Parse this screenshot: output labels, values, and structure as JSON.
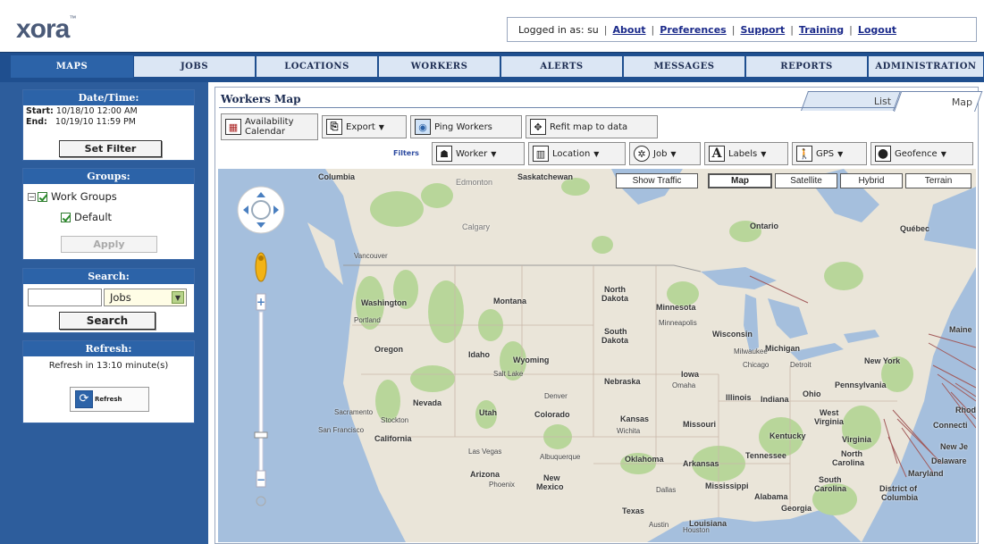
{
  "app": {
    "logo": "xora",
    "logo_mark": "™"
  },
  "header": {
    "logged_in_text": "Logged in as: su",
    "links": [
      "About",
      "Preferences",
      "Support",
      "Training",
      "Logout"
    ]
  },
  "nav": {
    "tabs": [
      "MAPS",
      "JOBS",
      "LOCATIONS",
      "WORKERS",
      "ALERTS",
      "MESSAGES",
      "REPORTS",
      "ADMINISTRATION"
    ],
    "active": "MAPS"
  },
  "sidebar": {
    "datetime": {
      "title": "Date/Time:",
      "start_label": "Start:",
      "start_value": "10/18/10 12:00 AM",
      "end_label": "End:",
      "end_value": "10/19/10 11:59 PM",
      "button": "Set Filter"
    },
    "groups": {
      "title": "Groups:",
      "items": [
        "Work Groups",
        "Default"
      ],
      "button": "Apply"
    },
    "search": {
      "title": "Search:",
      "input_value": "",
      "select_value": "Jobs",
      "button": "Search"
    },
    "refresh": {
      "title": "Refresh:",
      "text": "Refresh in 13:10 minute(s)",
      "button": "Refresh"
    }
  },
  "main": {
    "title": "Workers Map",
    "view_tabs": {
      "list": "List",
      "map": "Map"
    },
    "toolbar": {
      "availability_line1": "Availability",
      "availability_line2": "Calendar",
      "export": "Export",
      "ping": "Ping Workers",
      "refit": "Refit map to data"
    },
    "filters": {
      "label": "Filters",
      "items": [
        "Worker",
        "Location",
        "Job",
        "Labels",
        "GPS",
        "Geofence"
      ]
    },
    "map": {
      "show_traffic": "Show Traffic",
      "types": [
        "Map",
        "Satellite",
        "Hybrid",
        "Terrain"
      ],
      "active_type": "Map",
      "labels": {
        "columbia": "Columbia",
        "edmonton": "Edmonton",
        "saskatchewan": "Saskatchewan",
        "calgary": "Calgary",
        "ontario": "Ontario",
        "quebec": "Québec",
        "washington": "Washington",
        "montana": "Montana",
        "north_dakota_1": "North",
        "north_dakota_2": "Dakota",
        "minnesota": "Minnesota",
        "south_dakota_1": "South",
        "south_dakota_2": "Dakota",
        "wisconsin": "Wisconsin",
        "michigan": "Michigan",
        "oregon": "Oregon",
        "idaho": "Idaho",
        "wyoming": "Wyoming",
        "new_york": "New York",
        "iowa": "Iowa",
        "nebraska": "Nebraska",
        "pennsylvania": "Pennsylvania",
        "nevada": "Nevada",
        "utah": "Utah",
        "colorado": "Colorado",
        "illinois": "Illinois",
        "indiana": "Indiana",
        "ohio": "Ohio",
        "kansas": "Kansas",
        "missouri": "Missouri",
        "west_virginia_1": "West",
        "west_virginia_2": "Virginia",
        "california": "California",
        "kentucky": "Kentucky",
        "virginia": "Virginia",
        "oklahoma": "Oklahoma",
        "arkansas": "Arkansas",
        "tennessee": "Tennessee",
        "north_carolina_1": "North",
        "north_carolina_2": "Carolina",
        "arizona": "Arizona",
        "new_mexico_1": "New",
        "new_mexico_2": "Mexico",
        "mississippi": "Mississippi",
        "alabama": "Alabama",
        "south_carolina_1": "South",
        "south_carolina_2": "Carolina",
        "texas": "Texas",
        "georgia": "Georgia",
        "louisiana": "Louisiana",
        "maine": "Maine",
        "connecticut": "Connecti",
        "rhode": "Rhod",
        "new_jersey": "New Je",
        "delaware": "Delaware",
        "maryland": "Maryland",
        "dc_1": "District of",
        "dc_2": "Columbia",
        "vancouver": "Vancouver",
        "portland": "Portland",
        "minneapolis": "Minneapolis",
        "milwaukee": "Milwaukee",
        "chicago": "Chicago",
        "detroit": "Detroit",
        "omaha": "Omaha",
        "denver": "Denver",
        "salt_lake": "Salt Lake",
        "sacramento": "Sacramento",
        "stockton": "Stockton",
        "san_francisco": "San Francisco",
        "las_vegas": "Las Vegas",
        "albuquerque": "Albuquerque",
        "phoenix": "Phoenix",
        "wichita": "Wichita",
        "dallas": "Dallas",
        "austin": "Austin",
        "houston": "Houston"
      }
    }
  },
  "colors": {
    "nav": "#1f4f8f",
    "panel_header": "#2c63a8",
    "water": "#a5bfdd",
    "park": "#b8d69a",
    "land": "#eae5d9"
  }
}
